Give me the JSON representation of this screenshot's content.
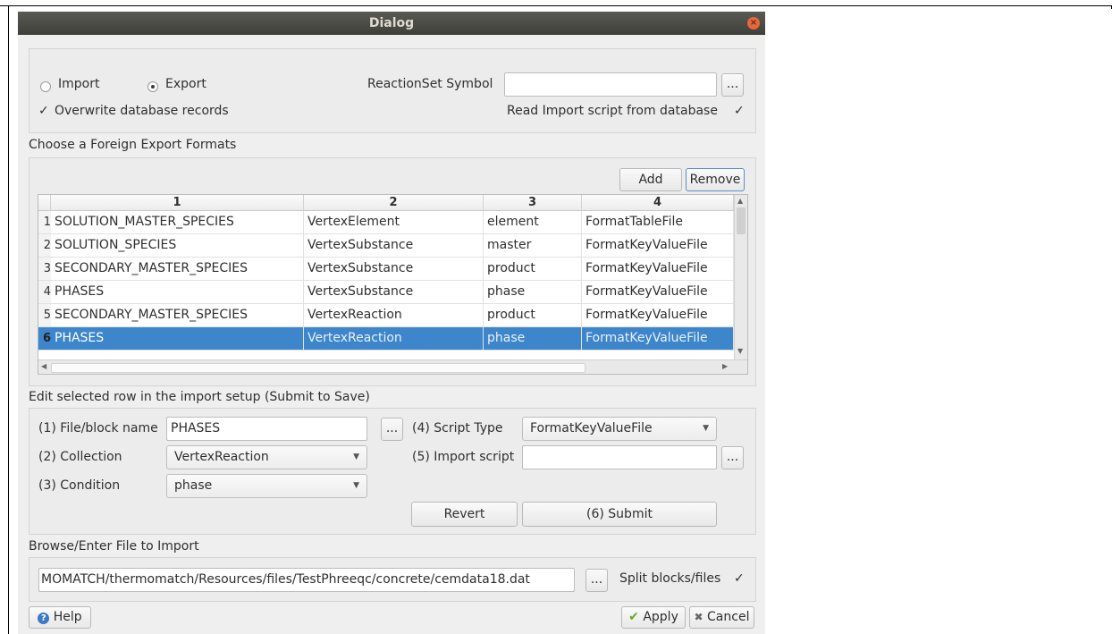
{
  "dialog": {
    "title": "Dialog"
  },
  "mode": {
    "import_label": "Import",
    "export_label": "Export",
    "selected": "export",
    "overwrite_label": "Overwrite database records",
    "overwrite_checked": true,
    "reactionset_label": "ReactionSet Symbol",
    "reactionset_value": "",
    "browse_label": "...",
    "read_script_label": "Read Import script from database",
    "read_script_checked": true
  },
  "formats": {
    "section_label": "Choose a  Foreign Export Formats",
    "add_label": "Add",
    "remove_label": "Remove",
    "columns": [
      "1",
      "2",
      "3",
      "4"
    ],
    "rows": [
      {
        "num": "1",
        "cells": [
          "SOLUTION_MASTER_SPECIES",
          "VertexElement",
          "element",
          "FormatTableFile"
        ]
      },
      {
        "num": "2",
        "cells": [
          "SOLUTION_SPECIES",
          "VertexSubstance",
          "master",
          "FormatKeyValueFile"
        ]
      },
      {
        "num": "3",
        "cells": [
          "SECONDARY_MASTER_SPECIES",
          "VertexSubstance",
          "product",
          "FormatKeyValueFile"
        ]
      },
      {
        "num": "4",
        "cells": [
          "PHASES",
          "VertexSubstance",
          "phase",
          "FormatKeyValueFile"
        ]
      },
      {
        "num": "5",
        "cells": [
          "SECONDARY_MASTER_SPECIES",
          "VertexReaction",
          "product",
          "FormatKeyValueFile"
        ]
      },
      {
        "num": "6",
        "cells": [
          "PHASES",
          "VertexReaction",
          "phase",
          "FormatKeyValueFile"
        ]
      }
    ],
    "selected_row": 6
  },
  "edit": {
    "section_label": "Edit selected row in the import setup (Submit to Save)",
    "file_block_label": "(1) File/block name",
    "file_block_value": "PHASES",
    "browse_label": "...",
    "collection_label": "(2) Collection",
    "collection_value": "VertexReaction",
    "condition_label": "(3) Condition",
    "condition_value": "phase",
    "script_type_label": "(4) Script Type",
    "script_type_value": "FormatKeyValueFile",
    "import_script_label": "(5) Import script",
    "import_script_value": "",
    "revert_label": "Revert",
    "submit_label": "(6) Submit"
  },
  "file": {
    "section_label": "Browse/Enter File to Import",
    "path_value": "MOMATCH/thermomatch/Resources/files/TestPhreeqc/concrete/cemdata18.dat",
    "browse_label": "...",
    "split_label": "Split blocks/files",
    "split_checked": true
  },
  "buttons": {
    "help": "Help",
    "apply": "Apply",
    "cancel": "Cancel"
  },
  "icons": {
    "check_mark": "✓",
    "dropdown": "▼",
    "scroll_up": "▲",
    "scroll_down": "▼",
    "scroll_left": "◀",
    "scroll_right": "▶",
    "help_icon": "?",
    "apply_icon": "✔",
    "cancel_icon": "✖",
    "close_icon": "×"
  },
  "colors": {
    "selection": "#3d86cb",
    "titlebar": "#45453f",
    "close": "#e8673c"
  }
}
